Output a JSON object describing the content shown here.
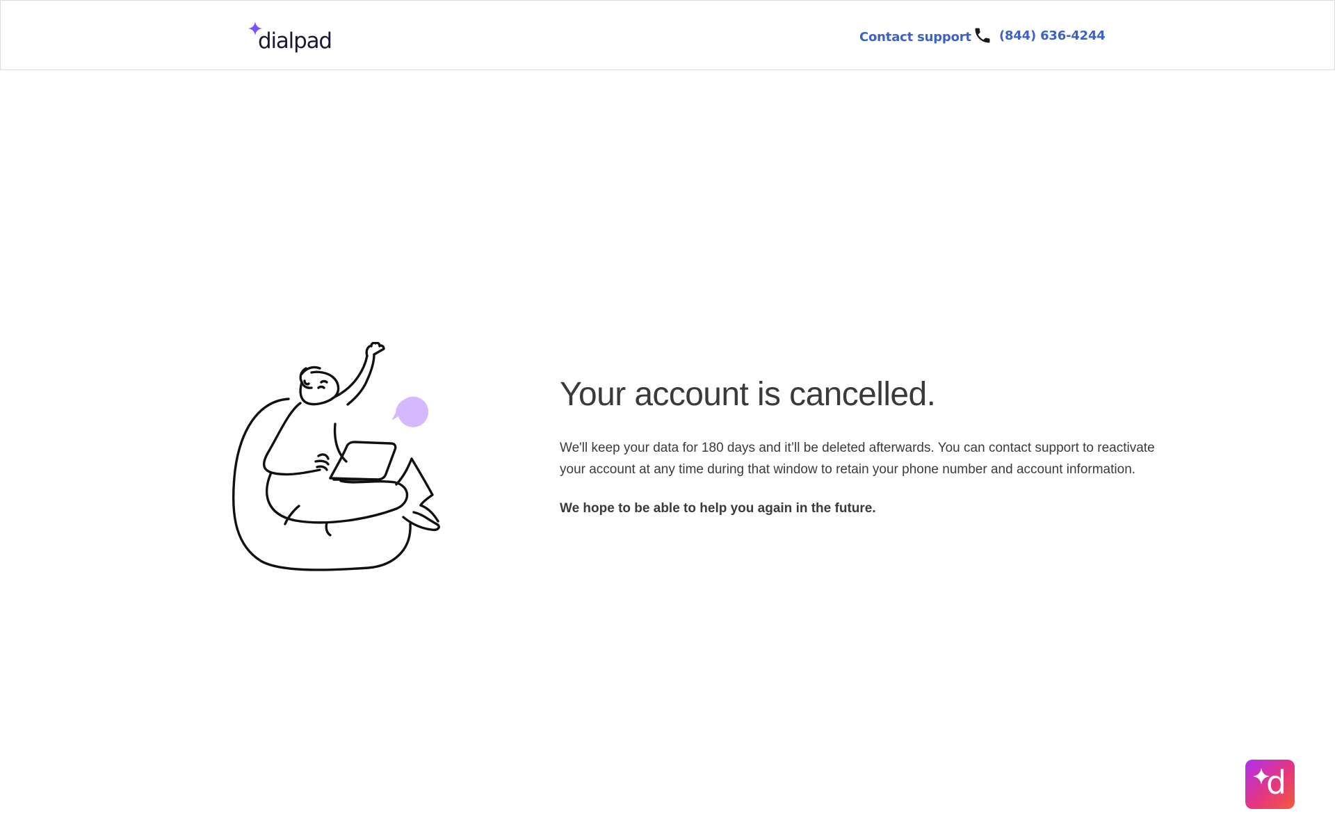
{
  "header": {
    "logo_text": "dialpad",
    "contact_label": "Contact support",
    "phone_number": "(844) 636-4244",
    "icons": {
      "logo": "sparkle-icon",
      "phone": "phone-icon"
    }
  },
  "main": {
    "title": "Your account is cancelled.",
    "body": "We'll keep your data for 180 days and it’ll be deleted afterwards. You can contact support to reactivate your account at any time during that window to retain your phone number and account information.",
    "closing": "We hope to be able to help you again in the future."
  },
  "assistant_button": {
    "letter": "d",
    "icon": "sparkle-icon"
  },
  "colors": {
    "link": "#3d62c4",
    "text": "#3a3a3c",
    "logo_sparkle": "#7c52ff",
    "speech_bubble": "#d4b9ff",
    "fab_gradient": [
      "#b02ff0",
      "#e5377f",
      "#f25b3a"
    ]
  }
}
